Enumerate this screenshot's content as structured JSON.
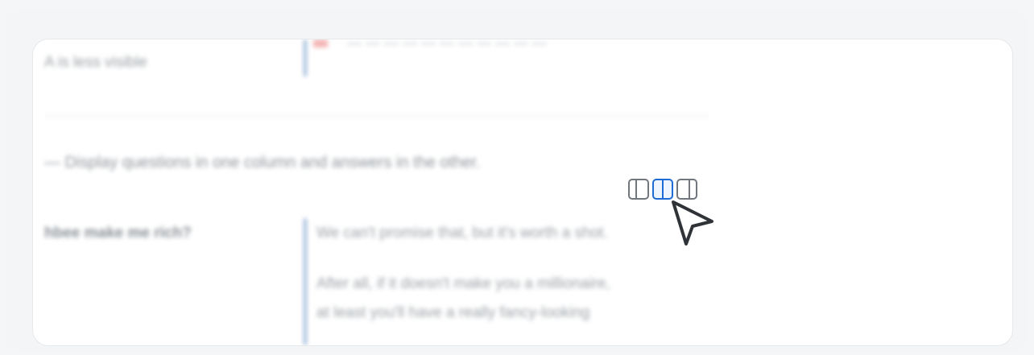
{
  "content": {
    "row_label": "A is less visible",
    "top_fragment": "— — — — — — — — — — —",
    "description": "— Display questions in one column and answers in the other.",
    "question": "hbee make me rich?",
    "answer_lines": [
      "We can't promise that, but it's worth a shot.",
      "After all, if it doesn't make you a millionaire,",
      "at least you'll have a really fancy-looking"
    ]
  },
  "layout_controls": [
    {
      "name": "layout-left-icon",
      "state": "inactive"
    },
    {
      "name": "layout-center-icon",
      "state": "active"
    },
    {
      "name": "layout-right-icon",
      "state": "inactive"
    }
  ],
  "colors": {
    "accent": "#1f6bd6",
    "divider": "#9ab8d8"
  }
}
